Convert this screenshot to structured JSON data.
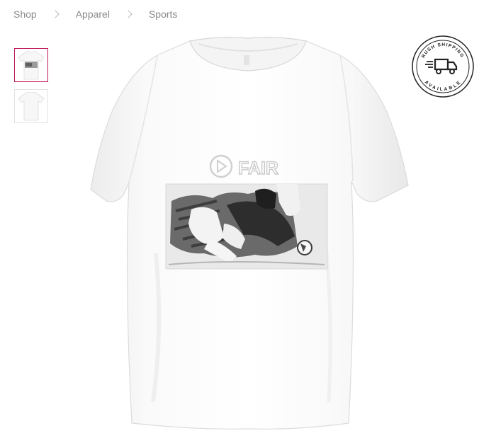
{
  "breadcrumb": [
    {
      "label": "Shop"
    },
    {
      "label": "Apparel"
    },
    {
      "label": "Sports"
    }
  ],
  "gallery": {
    "thumbnails": [
      {
        "name": "front-view",
        "active": true
      },
      {
        "name": "back-view",
        "active": false
      }
    ]
  },
  "product": {
    "print_logo_text": "FAIR",
    "color": "#ffffff",
    "accent": "#c2185b"
  },
  "badge": {
    "top_text": "RUSH SHIPPING",
    "bottom_text": "AVAILABLE",
    "icon": "truck-icon"
  }
}
